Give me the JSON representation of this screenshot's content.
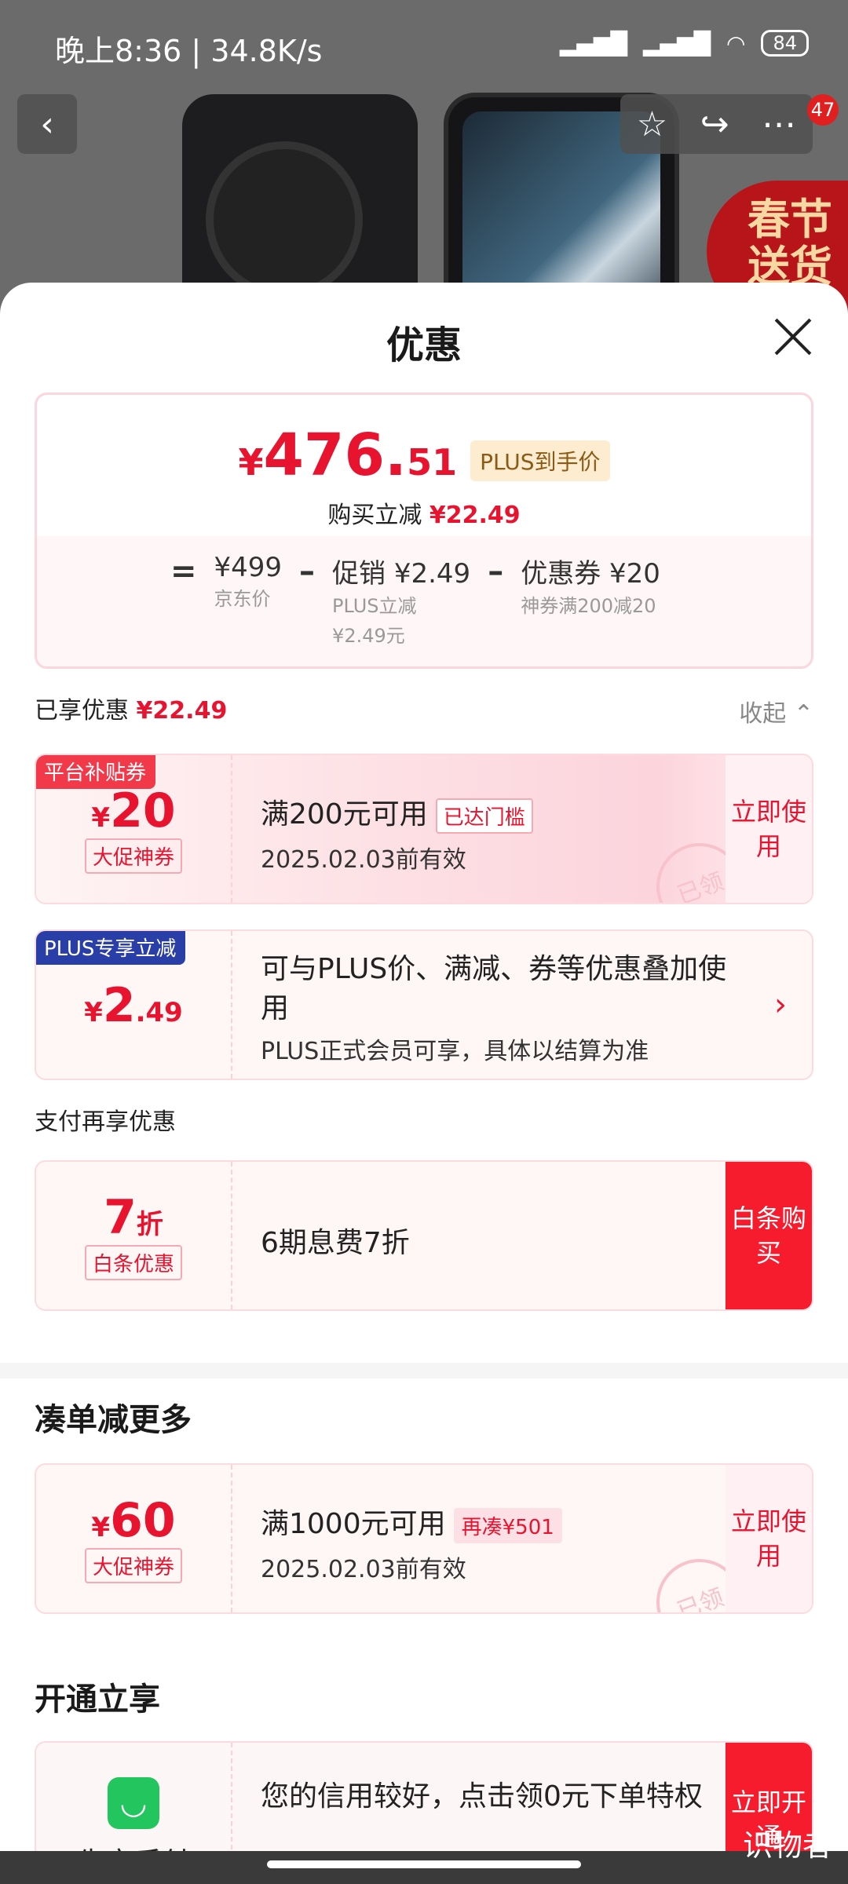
{
  "status_bar": {
    "time": "晚上8:36 | 34.8K/s",
    "battery": "84"
  },
  "header_actions": {
    "badge_count": "47"
  },
  "promo_banner": "春节送货",
  "sheet": {
    "title": "优惠"
  },
  "price_summary": {
    "currency": "¥",
    "price_int": "476.",
    "price_dec": "51",
    "plus_tag": "PLUS到手价",
    "cut_label": "购买立减",
    "cut_value": "¥22.49",
    "formula": {
      "equals": "=",
      "jd_price": "¥499",
      "jd_price_label": "京东价",
      "minus1": "–",
      "promo": "促销 ¥2.49",
      "promo_sub1": "PLUS立减",
      "promo_sub2": "¥2.49元",
      "minus2": "–",
      "coupon": "优惠券 ¥20",
      "coupon_sub": "神券满200减20"
    }
  },
  "enjoyed": {
    "label": "已享优惠",
    "value": "¥22.49",
    "collapse": "收起 ⌃"
  },
  "coupons": [
    {
      "corner": "平台补贴券",
      "currency": "¥",
      "amount": "20",
      "decimal": "",
      "tag": "大促神券",
      "title": "满200元可用",
      "chip": "已达门槛",
      "validity": "2025.02.03前有效",
      "action": "立即使用",
      "stamp": "已领"
    },
    {
      "corner": "PLUS专享立减",
      "currency": "¥",
      "amount": "2",
      "decimal": ".49",
      "title": "可与PLUS价、满减、券等优惠叠加使用",
      "subtitle": "PLUS正式会员可享，具体以结算为准",
      "arrow": "›"
    }
  ],
  "pay_section": {
    "title": "支付再享优惠",
    "amount": "7",
    "unit": "折",
    "tag": "白条优惠",
    "desc": "6期息费7折",
    "action": "白条购买"
  },
  "bundle_section": {
    "title": "凑单减更多",
    "currency": "¥",
    "amount": "60",
    "tag": "大促神券",
    "desc": "满1000元可用",
    "chip": "再凑¥501",
    "validity": "2025.02.03前有效",
    "action": "立即使用",
    "stamp": "已领"
  },
  "open_section": {
    "title": "开通立享",
    "app_name": "先享后付",
    "desc": "您的信用较好，点击领0元下单特权",
    "action": "立即开通"
  },
  "watermark": "识物者",
  "colors": {
    "accent": "#e8132e",
    "button_red": "#f61b2d",
    "plus_blue": "#2a3ea8",
    "green": "#22c55e"
  }
}
